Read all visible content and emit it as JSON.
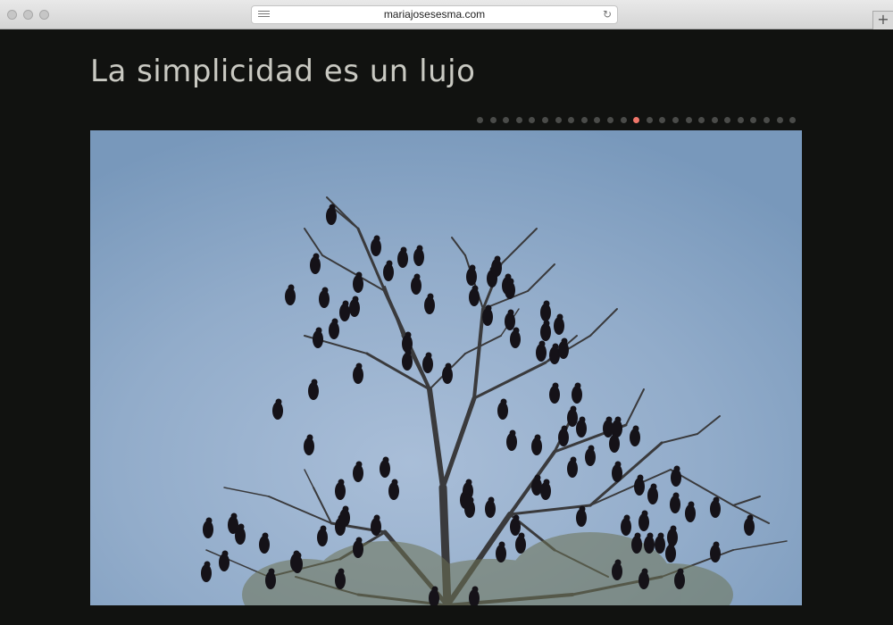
{
  "browser": {
    "url": "mariajosesesma.com",
    "reload_icon": "reload-icon",
    "reader_icon": "reader-icon",
    "new_tab_icon": "plus-icon",
    "new_tab_symbol": "+"
  },
  "page": {
    "title": "La simplicidad es un lujo",
    "title_color": "#c9c9c2",
    "background": "#111210"
  },
  "slider": {
    "total_slides": 25,
    "active_slide": 13,
    "dot_color": "#4a4b49",
    "active_color": "#f0766a"
  },
  "photo": {
    "subject": "tree with many dark birds against a blue dusk sky"
  }
}
